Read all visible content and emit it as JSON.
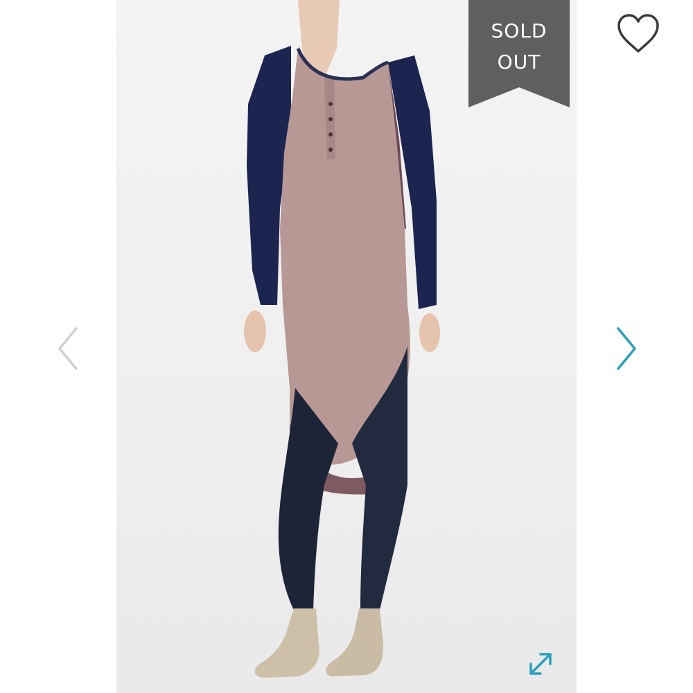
{
  "badge": {
    "line1": "SOLD",
    "line2": "OUT",
    "color": "#5f5f5f"
  },
  "icons": {
    "favorite": "heart-outline-icon",
    "previous": "chevron-left-icon",
    "next": "chevron-right-icon",
    "expand": "expand-arrows-icon"
  },
  "colors": {
    "accent": "#2a9fbc",
    "chevron_disabled": "#cfcfcf",
    "heart_stroke": "#3a3a3a"
  }
}
